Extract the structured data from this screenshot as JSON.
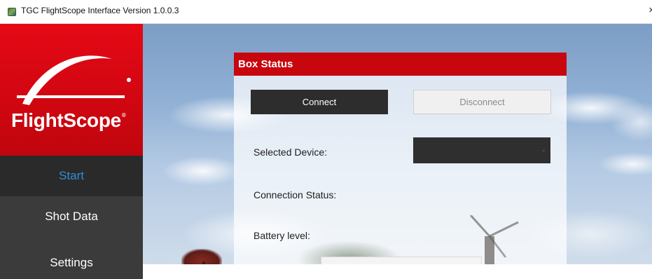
{
  "window": {
    "title": "TGC FlightScope Interface Version 1.0.0.3",
    "close_glyph": "×",
    "icon": "app-icon"
  },
  "sidebar": {
    "logo_text": "FlightScope",
    "logo_mark": "®",
    "items": [
      {
        "label": "Start",
        "active": true
      },
      {
        "label": "Shot Data",
        "active": false
      },
      {
        "label": "Settings",
        "active": false
      }
    ]
  },
  "box_status": {
    "header": "Box Status",
    "connect_label": "Connect",
    "disconnect_label": "Disconnect",
    "selected_device_label": "Selected Device:",
    "selected_device_value": "",
    "connection_status_label": "Connection Status:",
    "battery_level_label": "Battery level:"
  },
  "colors": {
    "brand_red": "#e50915",
    "header_red": "#c8060e",
    "active_nav_text": "#2f8fd8",
    "nav_bg": "#3b3b3b"
  }
}
